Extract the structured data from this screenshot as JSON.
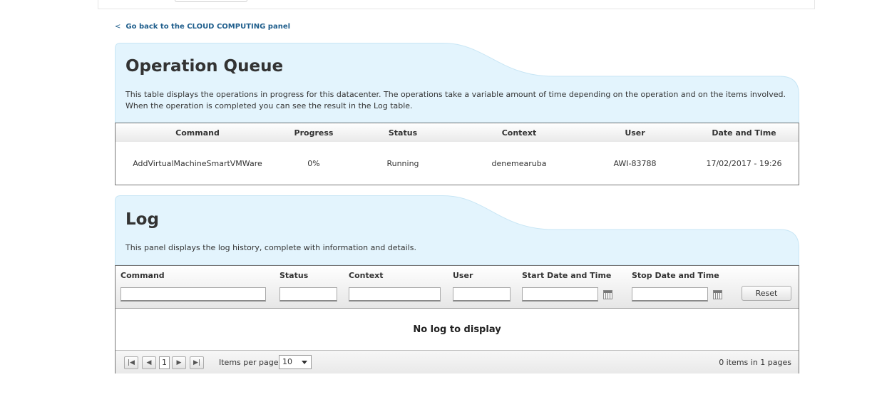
{
  "nav": {
    "back_link": "Go back to the CLOUD COMPUTING panel",
    "back_chevron": "<"
  },
  "queue": {
    "title": "Operation Queue",
    "description": "This table displays the operations in progress for this datacenter. The operations take a variable amount of time depending on the operation and on the items involved. When the operation is completed you can see the result in the Log table.",
    "columns": [
      "Command",
      "Progress",
      "Status",
      "Context",
      "User",
      "Date and Time"
    ],
    "rows": [
      [
        "AddVirtualMachineSmartVMWare",
        "0%",
        "Running",
        "denemearuba",
        "AWI-83788",
        "17/02/2017 - 19:26"
      ]
    ]
  },
  "log": {
    "title": "Log",
    "description": "This panel displays the log history, complete with information and details.",
    "filters": {
      "command": "Command",
      "status": "Status",
      "context": "Context",
      "user": "User",
      "start_date": "Start Date and Time",
      "stop_date": "Stop Date and Time"
    },
    "reset_label": "Reset",
    "empty_message": "No log to display",
    "pager": {
      "current_page": "1",
      "items_per_page_label": "Items per page",
      "items_per_page_value": "10",
      "info": "0 items in 1 pages"
    }
  },
  "colors": {
    "panel_bg": "#e3f4fd",
    "panel_border": "#c8e6f5",
    "link": "#1f5e8c"
  },
  "icons": [
    "first-page-icon",
    "prev-page-icon",
    "next-page-icon",
    "last-page-icon",
    "calendar-icon",
    "dropdown-arrow-icon"
  ]
}
